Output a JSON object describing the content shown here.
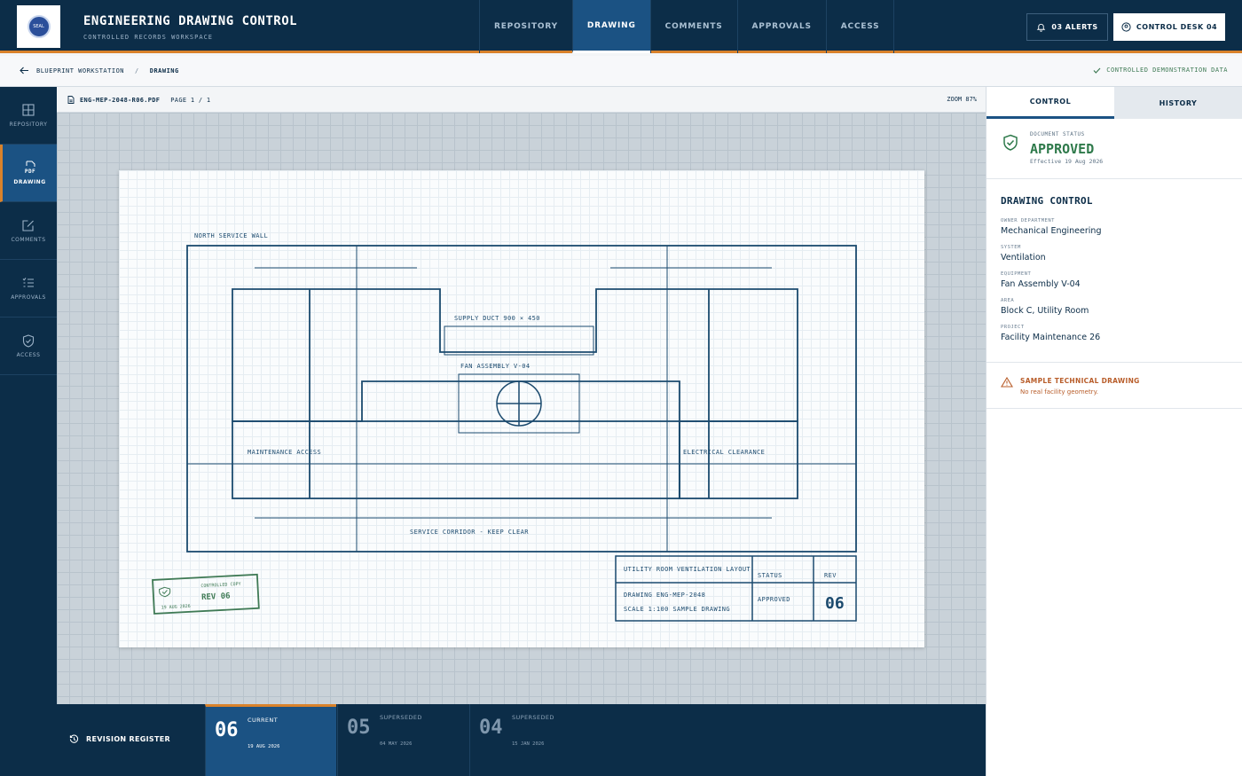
{
  "header": {
    "title": "ENGINEERING DRAWING CONTROL",
    "subtitle": "CONTROLLED RECORDS WORKSPACE",
    "logo_text": "SEAL",
    "nav": [
      "REPOSITORY",
      "DRAWING",
      "COMMENTS",
      "APPROVALS",
      "ACCESS"
    ],
    "active_nav": "DRAWING",
    "alerts_label": "03 ALERTS",
    "desk_label": "CONTROL DESK 04"
  },
  "breadcrumb": {
    "parent": "BLUEPRINT WORKSTATION",
    "separator": "/",
    "current": "DRAWING",
    "note": "CONTROLLED DEMONSTRATION DATA"
  },
  "rail": [
    {
      "label": "REPOSITORY",
      "icon": "grid-icon"
    },
    {
      "label": "DRAWING",
      "icon": "pdf-icon",
      "icon_text": "PDF"
    },
    {
      "label": "COMMENTS",
      "icon": "edit-icon"
    },
    {
      "label": "APPROVALS",
      "icon": "checklist-icon"
    },
    {
      "label": "ACCESS",
      "icon": "shield-icon"
    }
  ],
  "viewer": {
    "file": "ENG-MEP-2048-R06.PDF",
    "page": "PAGE 1 / 1",
    "zoom": "ZOOM 87%"
  },
  "drawing": {
    "north_wall": "NORTH SERVICE WALL",
    "supply_duct": "SUPPLY DUCT 900 × 450",
    "fan_assembly": "FAN ASSEMBLY V-04",
    "maintenance": "MAINTENANCE ACCESS",
    "electrical": "ELECTRICAL CLEARANCE",
    "corridor": "SERVICE CORRIDOR - KEEP CLEAR",
    "title_block": {
      "title": "UTILITY ROOM VENTILATION LAYOUT",
      "status_head": "STATUS",
      "rev_head": "REV",
      "drawing_no": "DRAWING ENG-MEP-2048",
      "scale": "SCALE 1:100 SAMPLE DRAWING",
      "status": "APPROVED",
      "rev": "06"
    },
    "stamp": {
      "caption": "CONTROLLED COPY",
      "rev": "REV 06",
      "date": "19 AUG 2026"
    }
  },
  "revisions": {
    "title": "REVISION REGISTER",
    "items": [
      {
        "num": "06",
        "status": "CURRENT",
        "date": "19 AUG 2026"
      },
      {
        "num": "05",
        "status": "SUPERSEDED",
        "date": "04 MAY 2026"
      },
      {
        "num": "04",
        "status": "SUPERSEDED",
        "date": "15 JAN 2026"
      }
    ]
  },
  "panel": {
    "tabs": [
      "CONTROL",
      "HISTORY"
    ],
    "status_caption": "DOCUMENT STATUS",
    "status_value": "APPROVED",
    "status_effective": "Effective 19 Aug 2026",
    "section_title": "DRAWING CONTROL",
    "fields": [
      {
        "label": "OWNER DEPARTMENT",
        "value": "Mechanical Engineering"
      },
      {
        "label": "SYSTEM",
        "value": "Ventilation"
      },
      {
        "label": "EQUIPMENT",
        "value": "Fan Assembly V-04"
      },
      {
        "label": "AREA",
        "value": "Block C, Utility Room"
      },
      {
        "label": "PROJECT",
        "value": "Facility Maintenance 26"
      }
    ],
    "warning_title": "SAMPLE TECHNICAL DRAWING",
    "warning_sub": "No real facility geometry."
  },
  "colors": {
    "navy": "#0c2d48",
    "active_blue": "#1b5283",
    "accent_orange": "#d9822b",
    "approved_green": "#2f7a4b",
    "warning_orange": "#b85d2a"
  }
}
